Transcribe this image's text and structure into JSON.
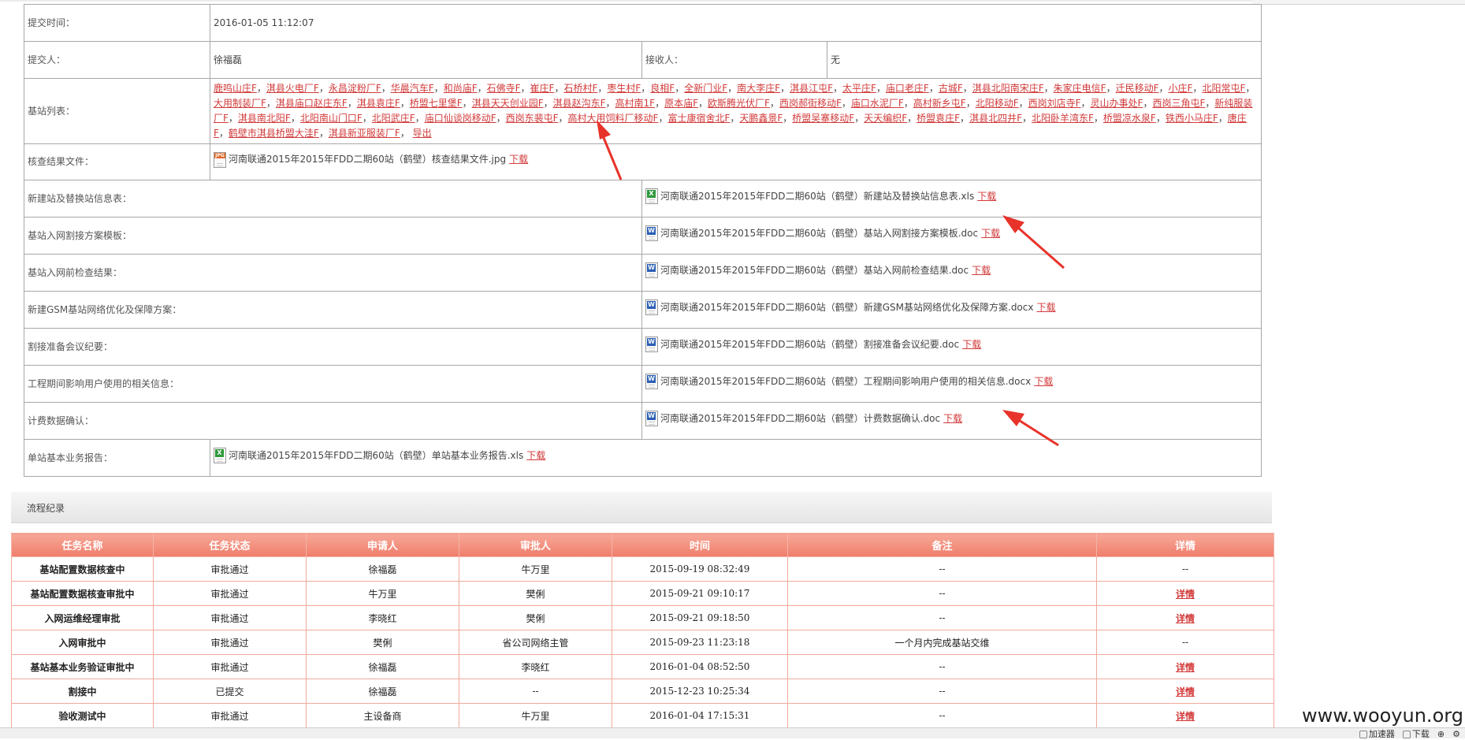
{
  "info": {
    "submit_time_label": "提交时间：",
    "submit_time_value": "2016-01-05 11:12:07",
    "submitter_label": "提交人：",
    "submitter_value": "徐福磊",
    "receiver_label": "接收人：",
    "receiver_value": "无",
    "site_list_label": "基站列表：",
    "export_label": "导出",
    "sites": [
      "鹿鸣山庄F",
      "淇县火电厂F",
      "永昌淀粉厂F",
      "华晨汽车F",
      "和尚庙F",
      "石佛寺F",
      "崔庄F",
      "石桥村F",
      "枣生村F",
      "良相F",
      "全新门业F",
      "南大李庄F",
      "淇县江屯F",
      "太平庄F",
      "庙口老庄F",
      "古城F",
      "淇县北阳南宋庄F",
      "朱家庄电信F",
      "迁民移动F",
      "小庄F",
      "北阳常屯F",
      "大用制装厂F",
      "淇县庙口赵庄东F",
      "淇县袁庄F",
      "桥盟七里堡F",
      "淇县天天创业园F",
      "淇县赵沟东F",
      "高村南1F",
      "原本庙F",
      "欧斯腾光伏厂F",
      "西岗郝街移动F",
      "庙口水泥厂F",
      "高村新乡屯F",
      "北阳移动F",
      "西岗刘店寺F",
      "灵山办事处F",
      "西岗三角屯F",
      "新纯服装厂F",
      "淇县南北阳F",
      "北阳南山门口F",
      "北阳武庄F",
      "庙口仙谈岗移动F",
      "西岗东裴屯F",
      "高村大用饲料厂移动F",
      "富士康宿舍北F",
      "天鹏鑫景F",
      "桥盟吴寨移动F",
      "天天编织F",
      "桥盟袁庄F",
      "淇县北四井F",
      "北阳卧羊湾东F",
      "桥盟凉水泉F",
      "铁西小马庄F",
      "唐庄F",
      "鹤壁市淇县桥盟大洼F",
      "淇县新亚服装厂F"
    ]
  },
  "files": {
    "check_result_label": "核查结果文件：",
    "check_result_name": "河南联通2015年2015年FDD二期60站（鹤壁）核查结果文件.jpg",
    "download_label": "下载",
    "rows": [
      {
        "label": "新建站及替换站信息表：",
        "name": "河南联通2015年2015年FDD二期60站（鹤壁）新建站及替换站信息表.xls",
        "icon": "excel"
      },
      {
        "label": "基站入网割接方案模板：",
        "name": "河南联通2015年2015年FDD二期60站（鹤壁）基站入网割接方案模板.doc",
        "icon": "word"
      },
      {
        "label": "基站入网前检查结果：",
        "name": "河南联通2015年2015年FDD二期60站（鹤壁）基站入网前检查结果.doc",
        "icon": "word"
      },
      {
        "label": "新建GSM基站网络优化及保障方案：",
        "name": "河南联通2015年2015年FDD二期60站（鹤壁）新建GSM基站网络优化及保障方案.docx",
        "icon": "word"
      },
      {
        "label": "割接准备会议纪要：",
        "name": "河南联通2015年2015年FDD二期60站（鹤壁）割接准备会议纪要.doc",
        "icon": "word"
      },
      {
        "label": "工程期间影响用户使用的相关信息：",
        "name": "河南联通2015年2015年FDD二期60站（鹤壁）工程期间影响用户使用的相关信息.docx",
        "icon": "word"
      },
      {
        "label": "计费数据确认：",
        "name": "河南联通2015年2015年FDD二期60站（鹤壁）计费数据确认.doc",
        "icon": "word"
      }
    ],
    "report_label": "单站基本业务报告：",
    "report_name": "河南联通2015年2015年FDD二期60站（鹤壁）单站基本业务报告.xls"
  },
  "flow": {
    "title": "流程纪录",
    "headers": [
      "任务名称",
      "任务状态",
      "申请人",
      "审批人",
      "时间",
      "备注",
      "详情"
    ],
    "rows": [
      [
        "基站配置数据核查中",
        "审批通过",
        "徐福磊",
        "牛万里",
        "2015-09-19 08:32:49",
        "--",
        "--"
      ],
      [
        "基站配置数据核查审批中",
        "审批通过",
        "牛万里",
        "樊俐",
        "2015-09-21 09:10:17",
        "--",
        "详情"
      ],
      [
        "入网运维经理审批",
        "审批通过",
        "李晓红",
        "樊俐",
        "2015-09-21 09:18:50",
        "--",
        "详情"
      ],
      [
        "入网审批中",
        "审批通过",
        "樊俐",
        "省公司网络主管",
        "2015-09-23 11:23:18",
        "一个月内完成基站交维",
        "--"
      ],
      [
        "基站基本业务验证审批中",
        "审批通过",
        "徐福磊",
        "李晓红",
        "2016-01-04 08:52:50",
        "--",
        "详情"
      ],
      [
        "割接中",
        "已提交",
        "徐福磊",
        "--",
        "2015-12-23 10:25:34",
        "--",
        "详情"
      ],
      [
        "验收测试中",
        "审批通过",
        "主设备商",
        "牛万里",
        "2016-01-04 17:15:31",
        "--",
        "详情"
      ]
    ]
  },
  "watermark": "www.wooyun.org",
  "statusbar": {
    "accelerator": "加速器",
    "download": "下载"
  },
  "colors": {
    "link_red": "#d23a3a",
    "header_salmon": "#ef7d6b",
    "arrow_red": "#e8332a"
  }
}
